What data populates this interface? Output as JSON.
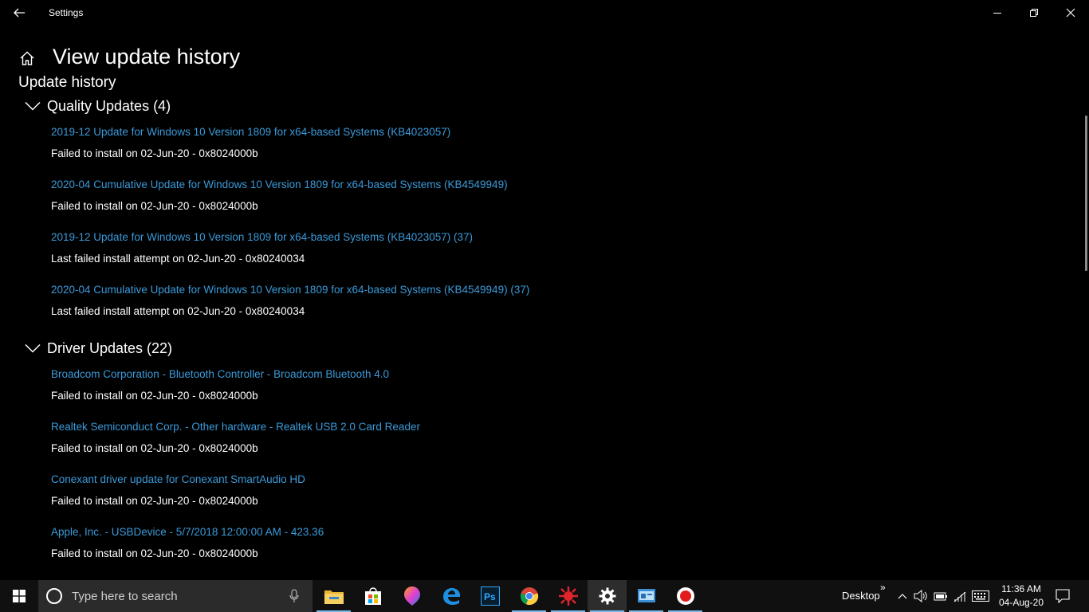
{
  "window": {
    "title": "Settings"
  },
  "header": {
    "title": "View update history",
    "section": "Update history"
  },
  "groups": [
    {
      "label": "Quality Updates (4)",
      "items": [
        {
          "name": "2019-12 Update for Windows 10 Version 1809 for x64-based Systems (KB4023057)",
          "status": "Failed to install on 02-Jun-20 - 0x8024000b"
        },
        {
          "name": "2020-04 Cumulative Update for Windows 10 Version 1809 for x64-based Systems (KB4549949)",
          "status": "Failed to install on 02-Jun-20 - 0x8024000b"
        },
        {
          "name": "2019-12 Update for Windows 10 Version 1809 for x64-based Systems (KB4023057) (37)",
          "status": "Last failed install attempt on 02-Jun-20 - 0x80240034"
        },
        {
          "name": "2020-04 Cumulative Update for Windows 10 Version 1809 for x64-based Systems (KB4549949) (37)",
          "status": "Last failed install attempt on 02-Jun-20 - 0x80240034"
        }
      ]
    },
    {
      "label": "Driver Updates (22)",
      "items": [
        {
          "name": "Broadcom Corporation - Bluetooth Controller - Broadcom Bluetooth 4.0",
          "status": "Failed to install on 02-Jun-20 - 0x8024000b"
        },
        {
          "name": "Realtek Semiconduct Corp. - Other hardware - Realtek USB 2.0 Card Reader",
          "status": "Failed to install on 02-Jun-20 - 0x8024000b"
        },
        {
          "name": "Conexant driver update for Conexant SmartAudio HD",
          "status": "Failed to install on 02-Jun-20 - 0x8024000b"
        },
        {
          "name": "Apple, Inc. - USBDevice - 5/7/2018 12:00:00 AM - 423.36",
          "status": "Failed to install on 02-Jun-20 - 0x8024000b"
        }
      ]
    }
  ],
  "taskbar": {
    "search_placeholder": "Type here to search",
    "apps": [
      "file-explorer-icon",
      "store-icon",
      "paint-3d-icon",
      "edge-icon",
      "photoshop-icon",
      "chrome-icon",
      "virus-app-icon",
      "settings-gear-icon",
      "control-panel-icon",
      "screen-recorder-icon"
    ],
    "desktop_label": "Desktop",
    "tray_chevron": "»",
    "time": "11:36 AM",
    "date": "04-Aug-20"
  },
  "colors": {
    "link": "#3a9ad9",
    "background": "#000000",
    "taskbar": "#101010"
  }
}
